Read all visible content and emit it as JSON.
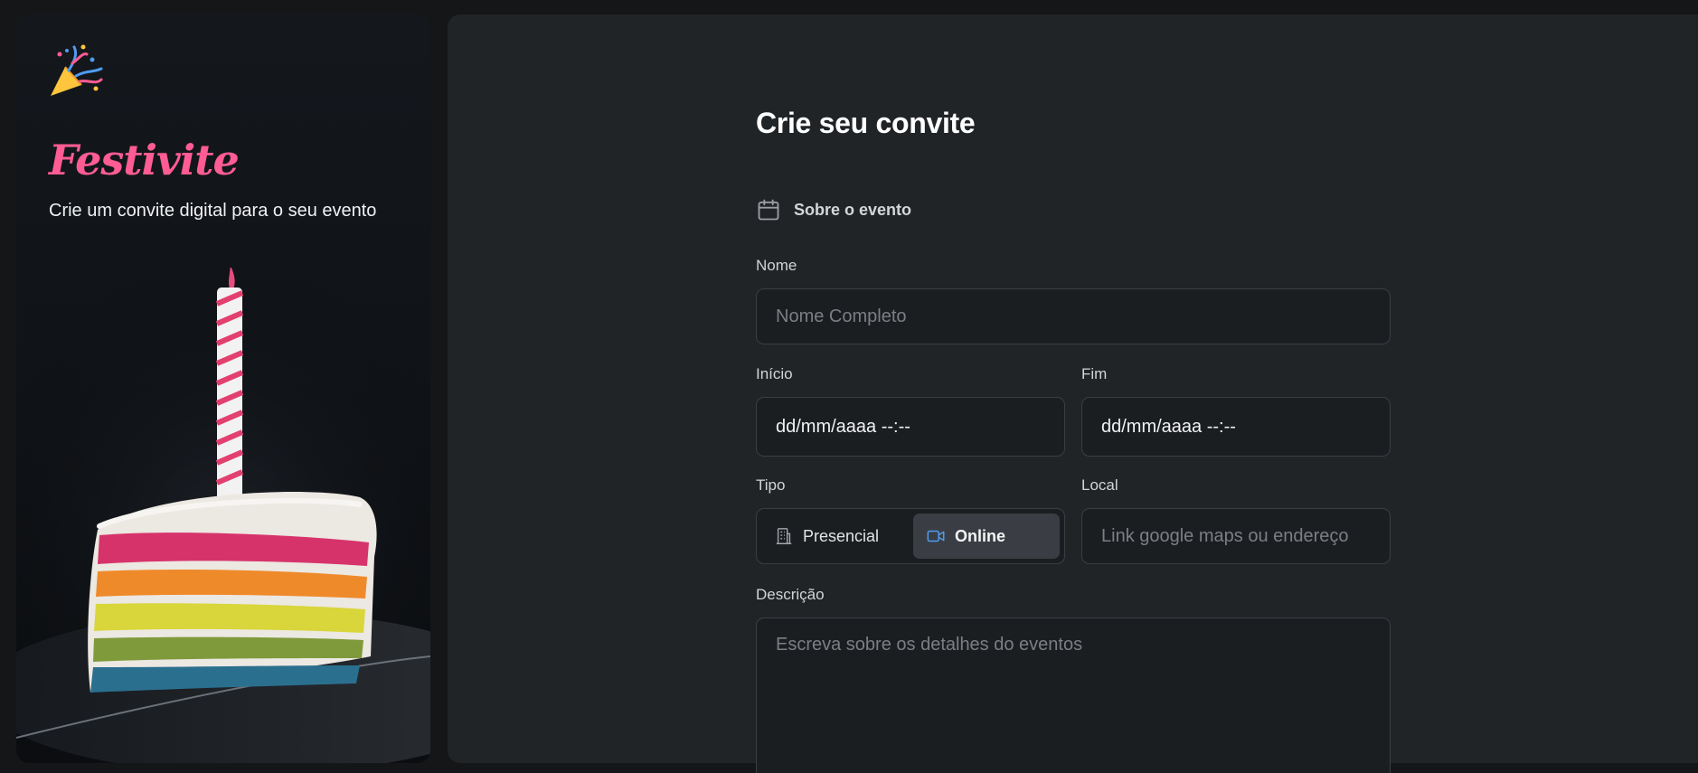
{
  "sidebar": {
    "brand": "Festivite",
    "tagline": "Crie um convite digital para o seu evento",
    "logo_icon": "party-popper-icon"
  },
  "form": {
    "title": "Crie seu convite",
    "section": {
      "icon": "calendar-icon",
      "label": "Sobre o evento"
    },
    "name": {
      "label": "Nome",
      "placeholder": "Nome Completo"
    },
    "start": {
      "label": "Início",
      "value": "dd/mm/aaaa --:--"
    },
    "end": {
      "label": "Fim",
      "value": "dd/mm/aaaa --:--"
    },
    "type": {
      "label": "Tipo",
      "options": [
        {
          "label": "Presencial",
          "icon": "building-icon",
          "selected": false
        },
        {
          "label": "Online",
          "icon": "video-camera-icon",
          "selected": true
        }
      ]
    },
    "location": {
      "label": "Local",
      "placeholder": "Link google maps ou endereço"
    },
    "description": {
      "label": "Descrição",
      "placeholder": "Escreva sobre os detalhes do eventos"
    }
  },
  "colors": {
    "brand": "#ff5c93",
    "background": "#212427",
    "field_bg": "#1b1e21",
    "accent_icon": "#4f9cf0"
  }
}
